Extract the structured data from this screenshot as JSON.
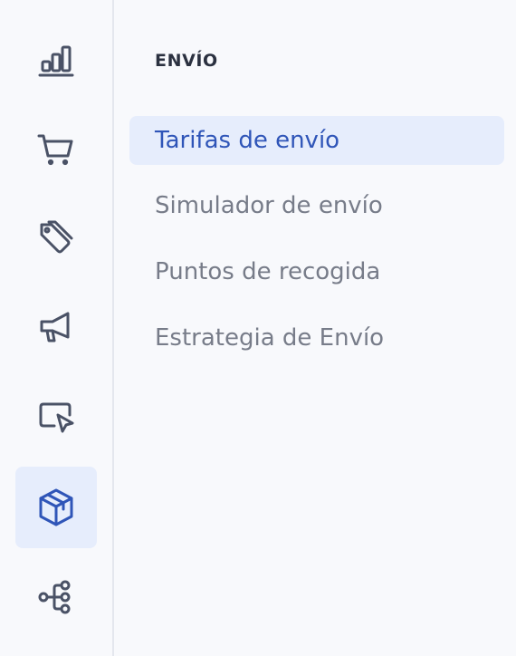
{
  "rail": {
    "items": [
      {
        "id": "analytics",
        "icon": "bar-chart-icon",
        "active": false
      },
      {
        "id": "orders",
        "icon": "shopping-cart-icon",
        "active": false
      },
      {
        "id": "products",
        "icon": "tags-icon",
        "active": false
      },
      {
        "id": "marketing",
        "icon": "megaphone-icon",
        "active": false
      },
      {
        "id": "online-store",
        "icon": "screen-cursor-icon",
        "active": false
      },
      {
        "id": "shipping",
        "icon": "package-box-icon",
        "active": true
      },
      {
        "id": "integrations",
        "icon": "workflow-icon",
        "active": false
      }
    ]
  },
  "submenu": {
    "title": "ENVÍO",
    "items": [
      {
        "label": "Tarifas de envío",
        "active": true
      },
      {
        "label": "Simulador de envío",
        "active": false
      },
      {
        "label": "Puntos de recogida",
        "active": false
      },
      {
        "label": "Estrategia de Envío",
        "active": false
      }
    ]
  },
  "colors": {
    "background": "#f8f9fc",
    "rail_border": "#e4e7ee",
    "active_background": "#e6edfc",
    "active_text": "#2f55b8",
    "inactive_text": "#777c89",
    "icon": "#4a5266",
    "title_text": "#2b3140"
  }
}
